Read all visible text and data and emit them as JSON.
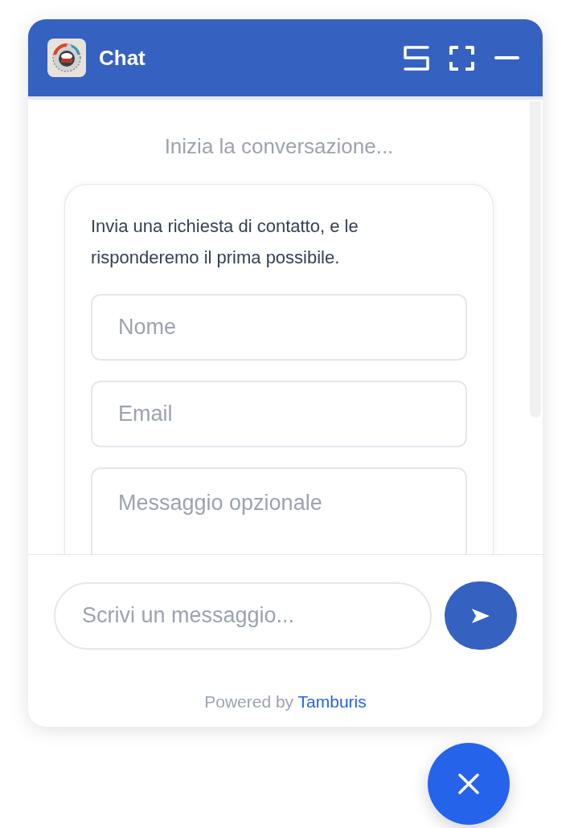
{
  "header": {
    "title": "Chat"
  },
  "body": {
    "intro": "Inizia la conversazione...",
    "card": {
      "message": "Invia una richiesta di contatto, e le risponderemo il prima possibile.",
      "fields": [
        {
          "kind": "input",
          "placeholder": "Nome"
        },
        {
          "kind": "input",
          "placeholder": "Email"
        },
        {
          "kind": "textarea",
          "placeholder": "Messaggio opzionale"
        }
      ]
    }
  },
  "composer": {
    "placeholder": "Scrivi un messaggio..."
  },
  "footer": {
    "text": "Powered by",
    "link": "Tamburis"
  }
}
